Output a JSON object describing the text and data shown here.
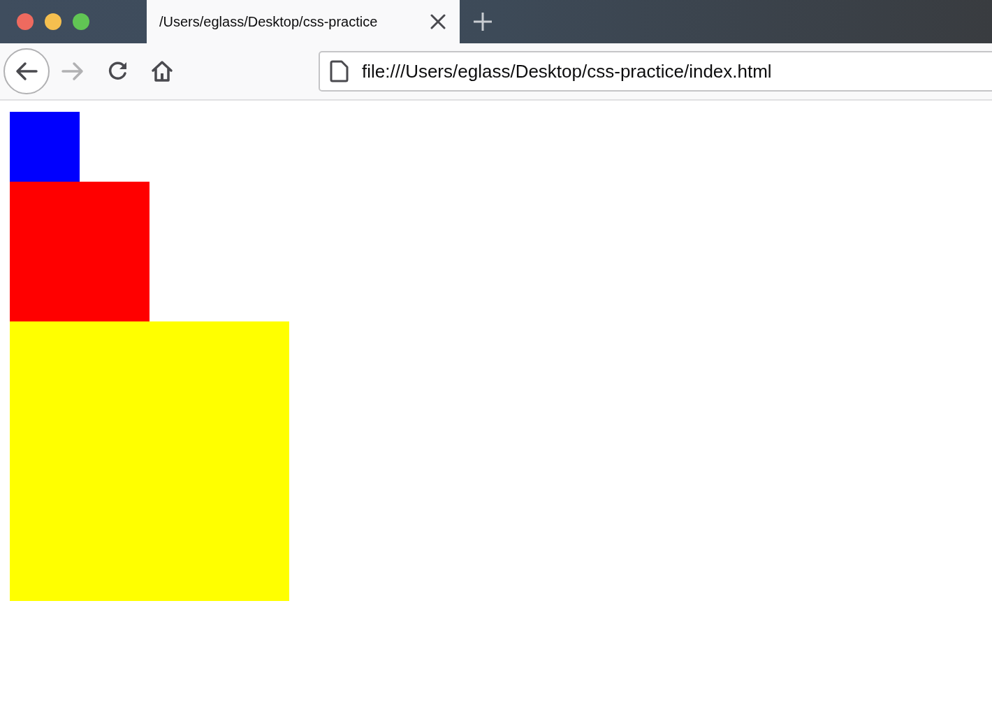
{
  "tabs": [
    {
      "title": "/Users/eglass/Desktop/css-practice",
      "selected": true
    }
  ],
  "toolbar": {
    "back": {
      "disabled": false
    },
    "forward": {
      "disabled": true
    },
    "address": "file:///Users/eglass/Desktop/css-practice/index.html"
  },
  "page": {
    "boxes": [
      {
        "color": "#0000ff"
      },
      {
        "color": "#ff0000"
      },
      {
        "color": "#ffff00"
      }
    ]
  }
}
